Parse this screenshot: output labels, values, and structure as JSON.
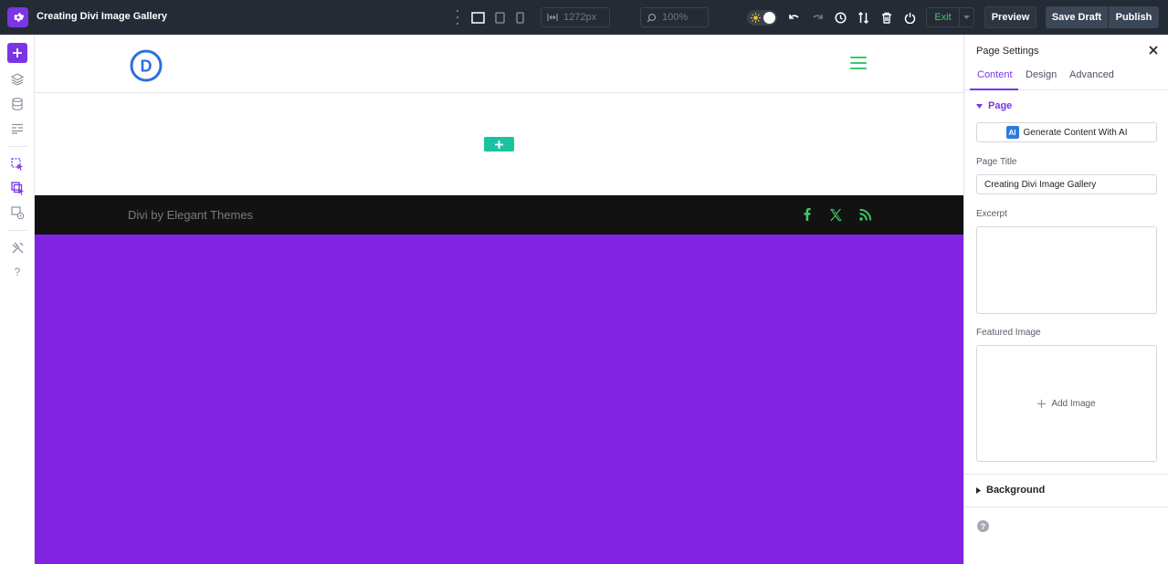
{
  "app": {
    "title": "Creating Divi Image Gallery",
    "settings_icon": "gear-icon"
  },
  "toolbar": {
    "width_value": "1272px",
    "zoom_value": "100%",
    "exit_label": "Exit",
    "preview_label": "Preview",
    "save_draft_label": "Save Draft",
    "publish_label": "Publish",
    "icons": [
      "more-vertical-icon",
      "desktop-view-icon",
      "tablet-view-icon",
      "phone-view-icon",
      "width-icon",
      "zoom-icon",
      "theme-toggle-icon",
      "undo-icon",
      "redo-icon",
      "history-icon",
      "sort-icon",
      "trash-icon",
      "power-icon"
    ]
  },
  "leftbar": {
    "icons": [
      "add-icon",
      "layers-icon",
      "database-icon",
      "layout-icon",
      "click-select-icon",
      "multi-select-icon",
      "settings-cog-icon",
      "tools-icon",
      "help-icon"
    ]
  },
  "canvas": {
    "footer_text": "Divi by Elegant Themes",
    "logo_letter": "D",
    "accent_green": "#3ec76a",
    "add_button_color": "#19c3a0",
    "section_color": "#8024e1",
    "footer_bg": "#121212"
  },
  "panel": {
    "title": "Page Settings",
    "tabs": [
      {
        "label": "Content",
        "active": true
      },
      {
        "label": "Design",
        "active": false
      },
      {
        "label": "Advanced",
        "active": false
      }
    ],
    "page_section": "Page",
    "ai_button_badge": "AI",
    "ai_button_label": "Generate Content With AI",
    "page_title_label": "Page Title",
    "page_title_value": "Creating Divi Image Gallery",
    "excerpt_label": "Excerpt",
    "excerpt_value": "",
    "featured_image_label": "Featured Image",
    "add_image_label": "Add Image",
    "background_section": "Background",
    "help_glyph": "?",
    "accent_color": "#7a35e6"
  }
}
